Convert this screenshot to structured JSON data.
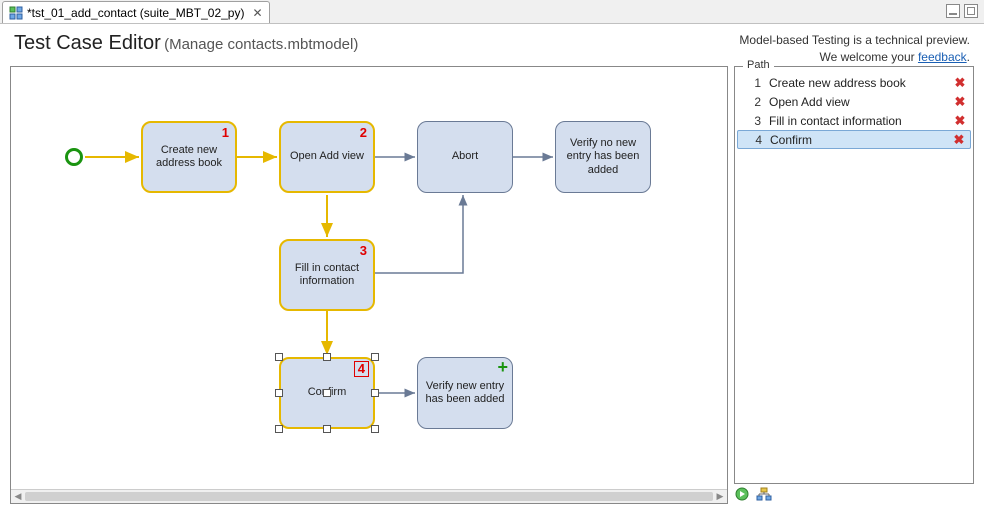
{
  "tab": {
    "label": "*tst_01_add_contact (suite_MBT_02_py)",
    "close_tooltip": "Close"
  },
  "header": {
    "title": "Test Case Editor",
    "subtitle": "(Manage contacts.mbtmodel)",
    "preview_line1": "Model-based Testing is a technical preview.",
    "preview_line2_prefix": "We welcome your ",
    "preview_link": "feedback",
    "preview_line2_suffix": "."
  },
  "nodes": {
    "n1": {
      "label": "Create new address book",
      "step": "1"
    },
    "n2": {
      "label": "Open Add view",
      "step": "2"
    },
    "n3": {
      "label": "Abort"
    },
    "n4": {
      "label": "Verify no new entry has been added"
    },
    "n5": {
      "label": "Fill in contact information",
      "step": "3"
    },
    "n6": {
      "label": "Confirm",
      "step": "4"
    },
    "n7": {
      "label": "Verify new entry has been added"
    }
  },
  "path_panel": {
    "title": "Path",
    "rows": [
      {
        "num": "1",
        "label": "Create new address book"
      },
      {
        "num": "2",
        "label": "Open Add view"
      },
      {
        "num": "3",
        "label": "Fill in contact information"
      },
      {
        "num": "4",
        "label": "Confirm"
      }
    ]
  }
}
